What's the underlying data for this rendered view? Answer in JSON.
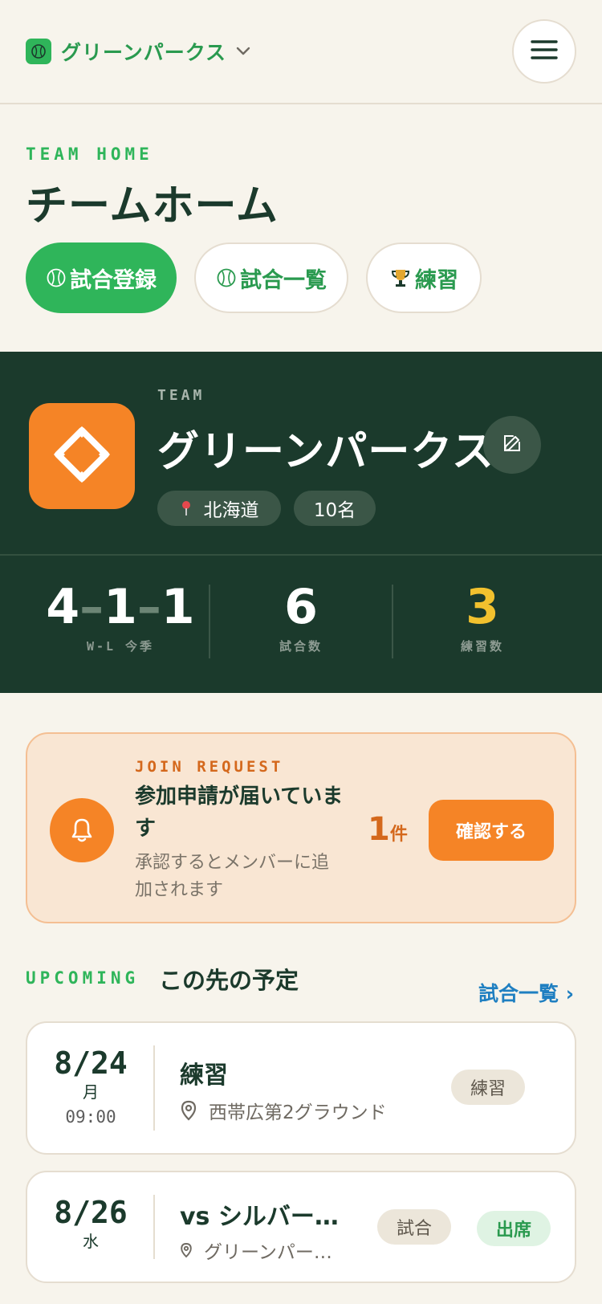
{
  "header": {
    "team_name": "グリーンパークス",
    "menu_icon": "hamburger-icon",
    "colors": {
      "brand_green": "#2fb55a"
    }
  },
  "page": {
    "eyebrow": "TEAM HOME",
    "title": "チームホーム"
  },
  "actions": [
    {
      "label": "試合登録",
      "icon": "baseball-icon"
    },
    {
      "label": "試合一覧",
      "icon": "baseball-icon"
    },
    {
      "label": "練習",
      "icon": "trophy-icon"
    }
  ],
  "team_card": {
    "label": "TEAM",
    "name": "グリーンパークス",
    "location": "北海道",
    "member_count": "10名",
    "colors": {
      "card_bg": "#1b3a2c",
      "avatar_bg": "#f58426",
      "highlight": "#f2c12e"
    },
    "stats": {
      "wins": "4",
      "losses": "1",
      "draws": "1",
      "record_label": "W-L 今季",
      "games": "6",
      "games_label": "試合数",
      "practices": "3",
      "practices_label": "練習数"
    }
  },
  "join_request": {
    "eyebrow": "JOIN REQUEST",
    "title": "参加申請が届いています",
    "subtitle": "承認するとメンバーに追加されます",
    "count": "1",
    "count_unit": "件",
    "button": "確認する",
    "icon": "bell-icon",
    "colors": {
      "accent": "#f58426"
    }
  },
  "upcoming": {
    "eyebrow": "UPCOMING",
    "title": "この先の予定",
    "link": "試合一覧 ›",
    "events": [
      {
        "date": "8/24",
        "weekday": "月",
        "time": "09:00",
        "title": "練習",
        "place": "西帯広第2グラウンド",
        "type": "練習"
      },
      {
        "date": "8/26",
        "weekday": "水",
        "title": "vs シルバー…",
        "place": "グリーンパー…",
        "type": "試合",
        "status": "出席"
      }
    ]
  }
}
